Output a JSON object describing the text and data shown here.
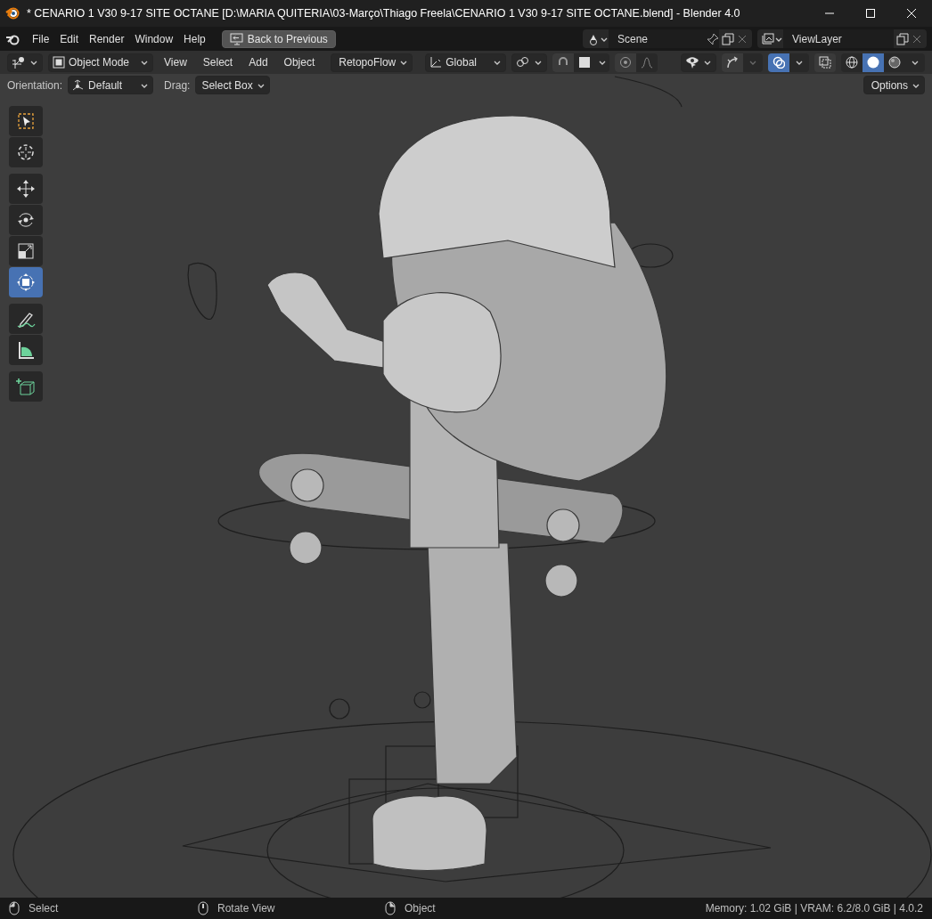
{
  "window": {
    "title": "* CENARIO 1 V30 9-17 SITE OCTANE [D:\\MARIA QUITERIA\\03-Março\\Thiago Freela\\CENARIO 1 V30 9-17 SITE OCTANE.blend] - Blender 4.0"
  },
  "topbar": {
    "menus": [
      "File",
      "Edit",
      "Render",
      "Window",
      "Help"
    ],
    "back_button": "Back to Previous",
    "scene": "Scene",
    "view_layer": "ViewLayer"
  },
  "header": {
    "mode": "Object Mode",
    "menus": [
      "View",
      "Select",
      "Add",
      "Object"
    ],
    "addon_menu": "RetopoFlow",
    "transform_orientation": "Global",
    "overlays_on": true,
    "xray_on": false,
    "shading": [
      {
        "kind": "wireframe",
        "selected": false
      },
      {
        "kind": "solid",
        "selected": true
      },
      {
        "kind": "material",
        "selected": false
      }
    ]
  },
  "tool_settings": {
    "orientation_label": "Orientation:",
    "orientation": "Default",
    "drag_label": "Drag:",
    "drag": "Select Box",
    "options": "Options"
  },
  "tool_groups": [
    [
      {
        "kind": "select",
        "selected": false
      },
      {
        "kind": "cursor",
        "selected": false
      }
    ],
    [
      {
        "kind": "move",
        "selected": false
      },
      {
        "kind": "rotate",
        "selected": false
      },
      {
        "kind": "scale",
        "selected": false
      },
      {
        "kind": "transform",
        "selected": true
      }
    ],
    [
      {
        "kind": "annotate",
        "selected": false
      },
      {
        "kind": "measure",
        "selected": false
      }
    ],
    [
      {
        "kind": "add_cube",
        "selected": false
      }
    ]
  ],
  "status_bar": {
    "hints": [
      {
        "kind": "left",
        "label": "Select"
      },
      {
        "kind": "middle",
        "label": "Rotate View"
      },
      {
        "kind": "right",
        "label": "Object"
      }
    ],
    "stats": "Memory: 1.02 GiB | VRAM: 6.2/8.0 GiB | 4.0.2"
  }
}
